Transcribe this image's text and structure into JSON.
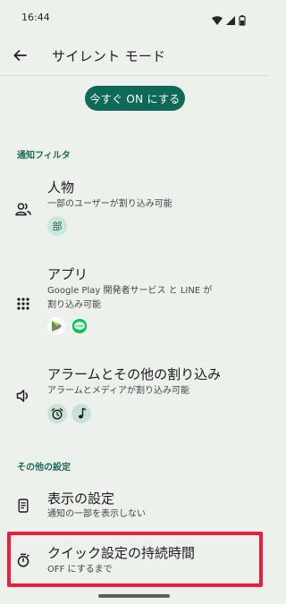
{
  "status_bar": {
    "time": "16:44"
  },
  "app_bar": {
    "title": "サイレント モード"
  },
  "cta": {
    "label": "今すぐ ON にする"
  },
  "sections": {
    "notification_filter": "通知フィルタ",
    "other_settings": "その他の設定"
  },
  "rows": {
    "people": {
      "title": "人物",
      "subtitle": "一部のユーザーが割り込み可能",
      "chip": "部"
    },
    "apps": {
      "title": "アプリ",
      "subtitle_line1": "Google Play 開発者サービス と LINE が",
      "subtitle_line2": "割り込み可能",
      "line_badge": "LINE"
    },
    "alarms": {
      "title": "アラームとその他の割り込み",
      "subtitle": "アラームとメディアが割り込み可能"
    },
    "display": {
      "title": "表示の設定",
      "subtitle": "通知の一部を表示しない"
    },
    "quick": {
      "title": "クイック設定の持続時間",
      "subtitle": "OFF にするまで"
    }
  },
  "colors": {
    "background": "#ecf1ec",
    "accent": "#0f6957",
    "highlight": "#ea1d3c"
  }
}
